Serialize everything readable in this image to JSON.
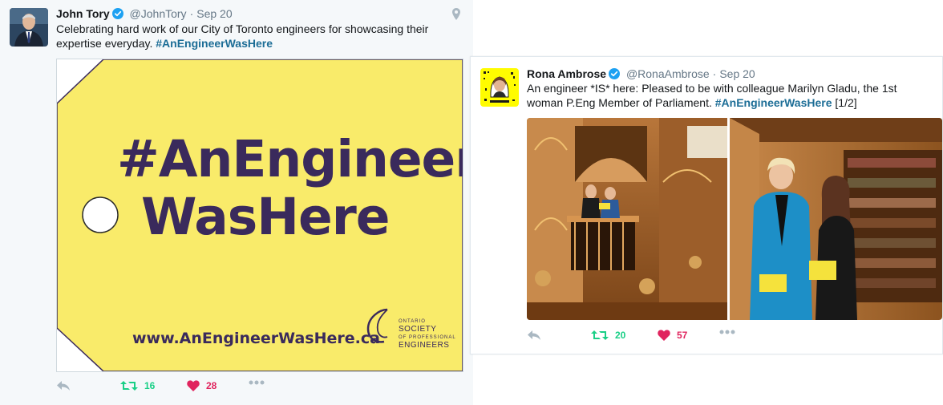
{
  "tweet1": {
    "name": "John Tory",
    "handle": "@JohnTory",
    "separator": "·",
    "date": "Sep 20",
    "text_before": "Celebrating hard work of our City of Toronto engineers for showcasing their expertise everyday. ",
    "hashtag": "#AnEngineerWasHere",
    "card": {
      "line1": "#AnEngineer",
      "line2": "WasHere",
      "url": "www.AnEngineerWasHere.ca",
      "logo_small": "ONTARIO",
      "logo_line1": "SOCIETY",
      "logo_line2": "OF PROFESSIONAL",
      "logo_line3": "ENGINEERS",
      "tag_color": "#f9eb6a",
      "text_color": "#3a2a5c"
    },
    "retweets": "16",
    "likes": "28"
  },
  "tweet2": {
    "name": "Rona Ambrose",
    "handle": "@RonaAmbrose",
    "separator": "·",
    "date": "Sep 20",
    "text_before": "An engineer *IS* here: Pleased to be with colleague Marilyn Gladu, the 1st woman P.Eng Member of Parliament. ",
    "hashtag": "#AnEngineerWasHere",
    "text_after": " [1/2]",
    "retweets": "20",
    "likes": "57"
  },
  "colors": {
    "retweet": "#19cf86",
    "like": "#e0245e",
    "icon": "#aab8c2",
    "verified": "#1da1f2",
    "hashtag": "#1c6d96"
  },
  "icons": [
    "verified-badge-icon",
    "location-pin-icon",
    "reply-icon",
    "retweet-icon",
    "heart-icon",
    "more-icon"
  ]
}
